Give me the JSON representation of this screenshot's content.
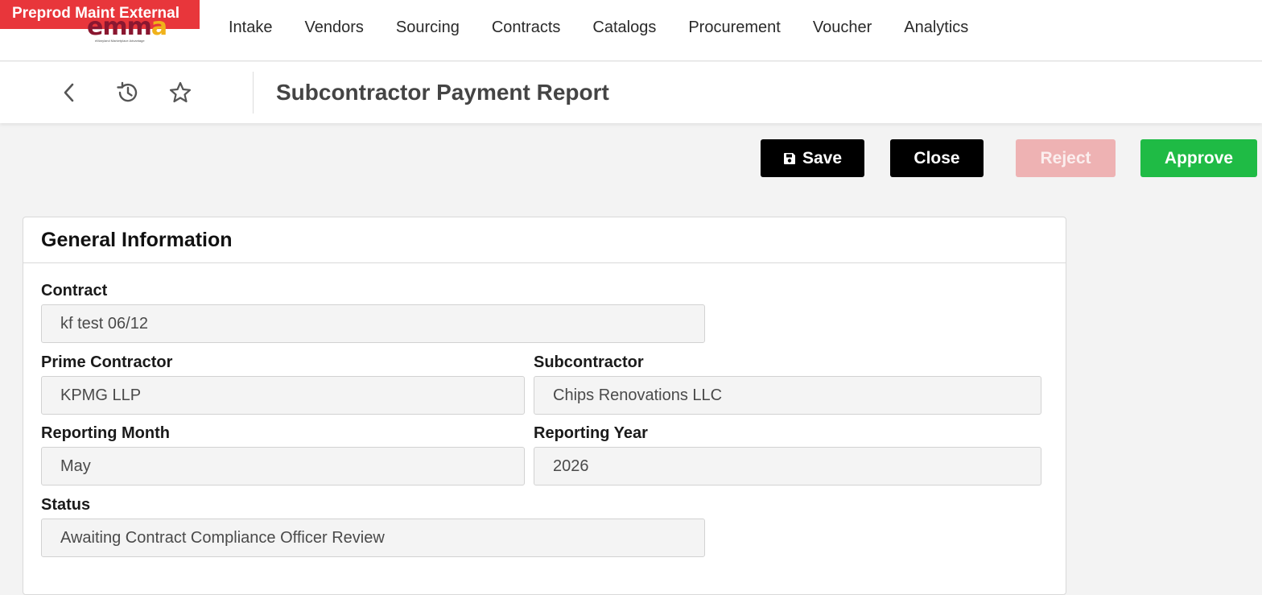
{
  "env_banner": "Preprod Maint External",
  "logo": {
    "text_main": "emm",
    "text_accent": "a",
    "tagline": "eMaryland Marketplace Advantage"
  },
  "nav": {
    "items": [
      {
        "label": "Intake"
      },
      {
        "label": "Vendors"
      },
      {
        "label": "Sourcing"
      },
      {
        "label": "Contracts"
      },
      {
        "label": "Catalogs"
      },
      {
        "label": "Procurement"
      },
      {
        "label": "Voucher"
      },
      {
        "label": "Analytics"
      }
    ]
  },
  "subheader": {
    "icons": [
      "back-chevron-icon",
      "history-icon",
      "star-icon"
    ],
    "title": "Subcontractor Payment Report"
  },
  "actions": {
    "save_label": "Save",
    "save_icon": "floppy-disk-icon",
    "close_label": "Close",
    "reject_label": "Reject",
    "approve_label": "Approve",
    "colors": {
      "save": "#000000",
      "close": "#000000",
      "reject": "#eeb2b3",
      "approve": "#1fbb45"
    },
    "reject_disabled": true
  },
  "general_info": {
    "title": "General Information",
    "fields": {
      "contract": {
        "label": "Contract",
        "value": "kf test 06/12"
      },
      "prime_contractor": {
        "label": "Prime Contractor",
        "value": "KPMG LLP"
      },
      "subcontractor": {
        "label": "Subcontractor",
        "value": "Chips Renovations LLC"
      },
      "reporting_month": {
        "label": "Reporting Month",
        "value": "May"
      },
      "reporting_year": {
        "label": "Reporting Year",
        "value": "2026"
      },
      "status": {
        "label": "Status",
        "value": "Awaiting Contract Compliance Officer Review"
      }
    }
  },
  "theme": {
    "banner_color": "#e8363b",
    "logo_color": "#8a1730",
    "logo_accent": "#f0b21a",
    "page_bg": "#f3f3f3"
  }
}
